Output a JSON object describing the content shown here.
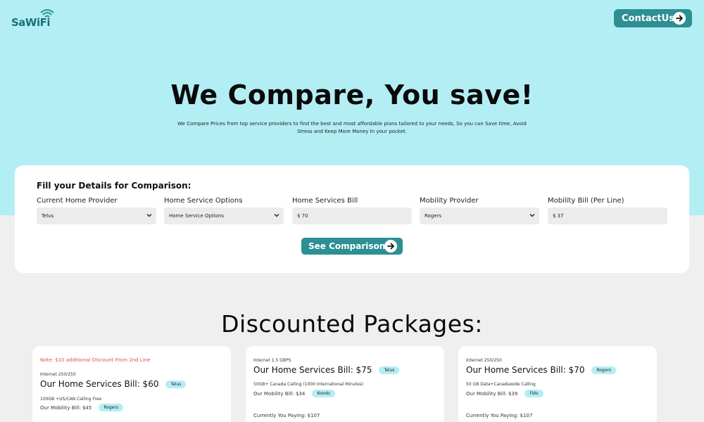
{
  "header": {
    "logo_text": "SaWiFi",
    "contact_label": "ContactUs"
  },
  "hero": {
    "title": "We Compare, You save!",
    "subtitle": "We Compare Prices from top service providers to find the best and most affordable plans tailored to your needs, So you can Save time, Avoid Stress and Keep More Money In your pocket."
  },
  "form": {
    "title": "Fill your Details for Comparison:",
    "fields": [
      {
        "label": "Current Home Provider",
        "value": "Telus",
        "type": "select"
      },
      {
        "label": "Home Service Options",
        "value": "Home Service Options",
        "type": "select"
      },
      {
        "label": "Home Services Bill",
        "value": "$  70",
        "type": "input"
      },
      {
        "label": "Mobility Provider",
        "value": "Rogers",
        "type": "select"
      },
      {
        "label": "Mobility Bill (Per Line)",
        "value": "$  37",
        "type": "input"
      }
    ],
    "button_label": "See Comparison"
  },
  "packages": {
    "title": "Discounted Packages:",
    "cards": [
      {
        "note": "Note: $10 additional Discount From 2nd Line",
        "internet": "Internet 250/250",
        "home_bill": "Our Home Services Bill: $60",
        "home_provider": "Telus",
        "mobility_plan": "100GB +US/CAN Calling Free",
        "mobility_bill": "Our Mobility Bill: $45",
        "mobility_provider": "Rogers",
        "paying": ""
      },
      {
        "note": "",
        "internet": "Internet 1.5 GBPS",
        "home_bill": "Our Home Services Bill: $75",
        "home_provider": "Telus",
        "mobility_plan": "50GB+ Canada Calling (1000 International Minutes)",
        "mobility_bill": "Our Mobility Bill: $34",
        "mobility_provider": "Koodo",
        "paying": "Currently You Paying: $107"
      },
      {
        "note": "",
        "internet": "Internet 250/250",
        "home_bill": "Our Home Services Bill: $70",
        "home_provider": "Rogers",
        "mobility_plan": "50 GB Data+Canadawide Calling",
        "mobility_bill": "Our Mobility Bill: $39",
        "mobility_provider": "Fido",
        "paying": "Currently You Paying: $107"
      }
    ]
  },
  "colors": {
    "hero_bg": "#b4eef5",
    "accent": "#2c8f93",
    "note_red": "#e0504a",
    "page_bg": "#efefef"
  },
  "icons": [
    "wifi-icon",
    "arrow-right-icon",
    "chevron-down-icon"
  ]
}
